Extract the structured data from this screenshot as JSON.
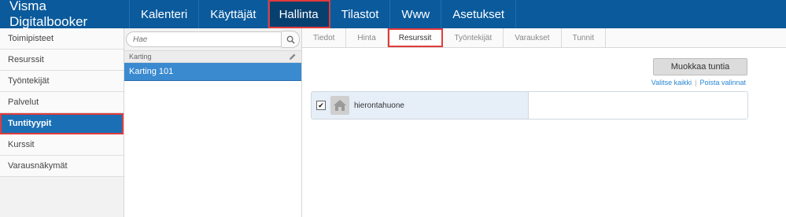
{
  "app": {
    "brand": "Visma Digitalbooker"
  },
  "nav": [
    {
      "label": "Kalenteri",
      "active": false
    },
    {
      "label": "Käyttäjät",
      "active": false
    },
    {
      "label": "Hallinta",
      "active": true
    },
    {
      "label": "Tilastot",
      "active": false
    },
    {
      "label": "Www",
      "active": false
    },
    {
      "label": "Asetukset",
      "active": false
    }
  ],
  "sidebar": {
    "items": [
      {
        "label": "Toimipisteet"
      },
      {
        "label": "Resurssit"
      },
      {
        "label": "Työntekijät"
      },
      {
        "label": "Palvelut"
      },
      {
        "label": "Tuntityypit"
      },
      {
        "label": "Kurssit"
      },
      {
        "label": "Varausnäkymät"
      }
    ]
  },
  "search": {
    "placeholder": "Hae"
  },
  "list": {
    "group": "Karting",
    "items": [
      {
        "label": "Karting 101"
      }
    ]
  },
  "tabs": [
    {
      "label": "Tiedot"
    },
    {
      "label": "Hinta"
    },
    {
      "label": "Resurssit"
    },
    {
      "label": "Työntekijät"
    },
    {
      "label": "Varaukset"
    },
    {
      "label": "Tunnit"
    }
  ],
  "actions": {
    "edit_button": "Muokkaa tuntia",
    "select_all": "Valitse kaikki",
    "deselect": "Poista valinnat"
  },
  "resource": {
    "name": "hierontahuone",
    "checked_mark": "✔"
  },
  "colors": {
    "topbar": "#0a5a9c",
    "accent": "#1a6fb5",
    "highlight": "#e23b3b"
  }
}
